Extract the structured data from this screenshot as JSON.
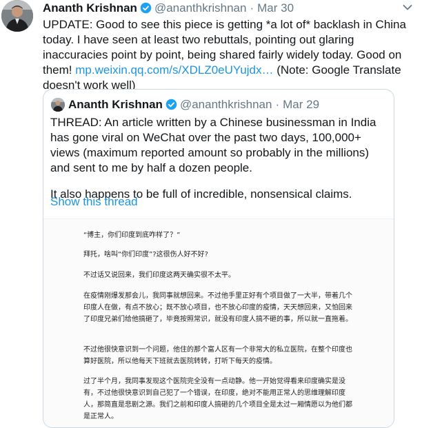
{
  "tweet": {
    "author_name": "Ananth Krishnan",
    "handle": "@ananthkrishnan",
    "separator": "·",
    "date": "Mar 30",
    "text_lead": "UPDATE: Good to see this piece is getting *a lot of* backlash in China today. I have seen at least two rebuttals, pointing out glaring inaccuracies point by point, being shared fairly widely today. Good on them! ",
    "link_text": "mp.weixin.qq.com/s/XDLZ0eUYujdx…",
    "text_tail": " (Note: Google Translate doesn't work well)"
  },
  "quote": {
    "author_name": "Ananth Krishnan",
    "handle": "@ananthkrishnan",
    "separator": "·",
    "date": "Mar 29",
    "paragraph_1": "THREAD: An article written by a Chinese businessman in India has gone viral on WeChat over the past two days, 100,000+ views (maximum reported amount so probably in the millions) and sent to me by half a dozen people.",
    "paragraph_2": "It also happens to be full of incredible, nonsensical claims.",
    "show_thread": "Show this thread",
    "document": [
      "“博主，你们印度到底咋样了？”",
      "拜托，啥叫“你们印度”?这很伤人好不好?",
      "不过话又说回来，我们印度这两天确实很不太平。",
      "在疫情刚爆发那会儿，我同事就想回来。不过他手里正好有个项目做了一大半，带着几个印度人在做，有点不放心；既不放心项目，也不放心印度的疫情，天天想回来，又怕回来了印度兄弟们给他搞砸了，毕竟按照常识，就没有印度人搞不砸的事，所以就一直拖着。",
      "不过他很快意识到一个问题，他住的那个富人区有一个非常大的私立医院，在整个印度也算好医院，所以他每天下班就去医院转转，打听下每天的疫情。",
      "过了半个月，我同事发现这个医院完全没有一点动静。他一开始觉得看来印度确实是没有，不过他很快意识到自己犯了一个错误，在印度，绝对不能用正常人的思维理解印度人，那简直是悲剧之源。我们之前和印度人搞砸的几个项目全是太过一厢情愿以为他们都是正常人。"
    ]
  }
}
